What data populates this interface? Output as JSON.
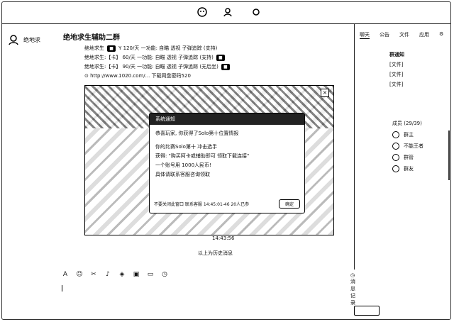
{
  "app": {
    "group_name": "绝地求生辅助二群",
    "sidebar_label": "绝地求"
  },
  "chat": {
    "messages": [
      {
        "sender": "绝地求生",
        "text": "Y  120/天 一功能: 自瞄 透视 子弹追踪 (支持)"
      },
      {
        "sender": "绝地求生:【卡】",
        "text": "60/天 一功能: 自瞄 透视 子弹追踪 (支持)"
      },
      {
        "sender": "绝地求生:【卡】",
        "text": "90/天 一功能: 自瞄 透视 子弹追踪 (无后坐)"
      }
    ],
    "link_text": "http://www.1020.com/... 下载网盘密码520",
    "time": "14:43:56",
    "notice": "以上为历史消息"
  },
  "dialog": {
    "title": "系统通知",
    "body": [
      "恭喜玩家, 你获得了Solo第十位置情报",
      "",
      "你的比赛Solo第十 冲击选手",
      "获得: \"购买阿卡或辅助即可 领取下载连接\"",
      "一个账号用 1000人民币!",
      "具体请联系客服咨询领取"
    ],
    "footer_text": "不要关闭此窗口 联系客服 14:45:01-46 20人已参",
    "button_label": "确定"
  },
  "toolbar": {
    "icons": [
      "font-icon",
      "emoji-icon",
      "scissors-icon",
      "mic-icon",
      "gift-icon",
      "image-icon",
      "folder-icon",
      "history-icon"
    ],
    "history_label": "消息记录"
  },
  "right_panel": {
    "tabs": [
      "聊天",
      "公告",
      "文件",
      "应用",
      "设置"
    ],
    "announcements_title": "群通知",
    "announcements": [
      "[文件]",
      "[文件]",
      "[文件]"
    ],
    "members_title": "成员 (29/39)",
    "members": [
      "群主",
      "不能王者",
      "群管",
      "群友"
    ]
  }
}
